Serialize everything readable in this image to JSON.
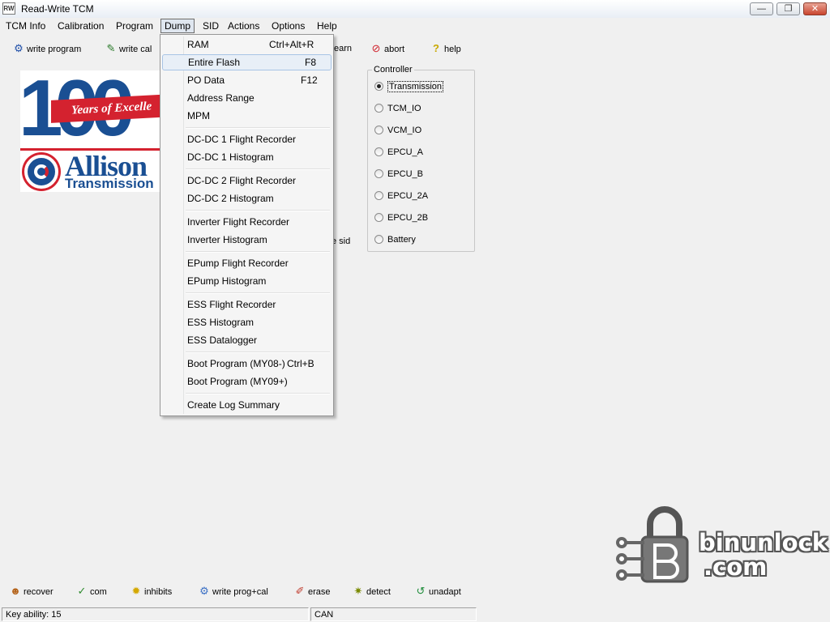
{
  "window": {
    "icon_text": "RW",
    "title": "Read-Write TCM",
    "minimize_glyph": "—",
    "maximize_glyph": "❐",
    "close_glyph": "✕"
  },
  "menubar": {
    "items": [
      "TCM Info",
      "Calibration",
      "Program",
      "Dump",
      "SID",
      "Actions",
      "Options",
      "Help"
    ],
    "open_item": "Dump"
  },
  "toolbar": {
    "write_program": "write program",
    "write_cal": "write cal",
    "learn_fragment": "earn",
    "abort": "abort",
    "help": "help"
  },
  "logo": {
    "hundred": "100",
    "ribbon": "Years of Excelle",
    "brand": "Allison",
    "brand_sub": "Transmission"
  },
  "background_fragments": {
    "sid_fragment": "e sid"
  },
  "dump_menu": {
    "items": [
      {
        "label": "RAM",
        "shortcut": "Ctrl+Alt+R"
      },
      {
        "label": "Entire Flash",
        "shortcut": "F8",
        "highlighted": true
      },
      {
        "label": "PO Data",
        "shortcut": "F12"
      },
      {
        "label": "Address Range",
        "shortcut": ""
      },
      {
        "label": "MPM",
        "shortcut": ""
      },
      {
        "label": "DC-DC 1 Flight Recorder",
        "shortcut": ""
      },
      {
        "label": "DC-DC 1 Histogram",
        "shortcut": ""
      },
      {
        "label": "DC-DC 2 Flight Recorder",
        "shortcut": ""
      },
      {
        "label": "DC-DC 2 Histogram",
        "shortcut": ""
      },
      {
        "label": "Inverter Flight Recorder",
        "shortcut": ""
      },
      {
        "label": "Inverter Histogram",
        "shortcut": ""
      },
      {
        "label": "EPump Flight Recorder",
        "shortcut": ""
      },
      {
        "label": "EPump Histogram",
        "shortcut": ""
      },
      {
        "label": "ESS Flight Recorder",
        "shortcut": ""
      },
      {
        "label": "ESS Histogram",
        "shortcut": ""
      },
      {
        "label": "ESS Datalogger",
        "shortcut": ""
      },
      {
        "label": "Boot Program (MY08-)",
        "shortcut": "Ctrl+B"
      },
      {
        "label": "Boot Program (MY09+)",
        "shortcut": ""
      },
      {
        "label": "Create Log Summary",
        "shortcut": ""
      }
    ]
  },
  "controller": {
    "title": "Controller",
    "options": [
      "Transmission",
      "TCM_IO",
      "VCM_IO",
      "EPCU_A",
      "EPCU_B",
      "EPCU_2A",
      "EPCU_2B",
      "Battery"
    ],
    "selected": "Transmission"
  },
  "bottom_toolbar": {
    "recover": "recover",
    "com": "com",
    "inhibits": "inhibits",
    "write_prog_cal": "write prog+cal",
    "erase": "erase",
    "detect": "detect",
    "unadapt": "unadapt"
  },
  "statusbar": {
    "key_ability": "Key ability: 15",
    "protocol": "CAN"
  },
  "watermark": {
    "line1": "binunlock",
    "line2": ".com"
  },
  "colors": {
    "allison_blue": "#1a4f93",
    "allison_red": "#d4222f",
    "menu_highlight": "#e8eff7",
    "window_bg": "#f0f0f0"
  }
}
